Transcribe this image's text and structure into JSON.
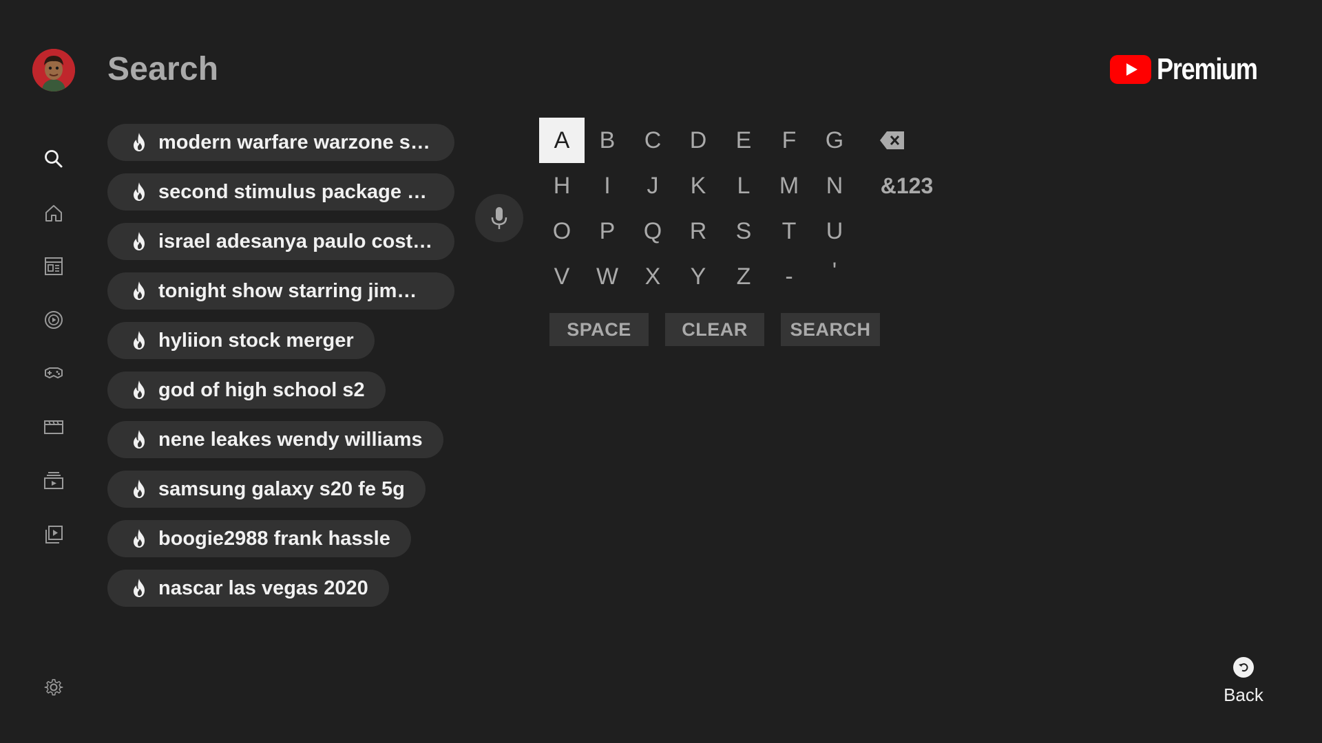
{
  "header": {
    "title": "Search",
    "logo_text": "Premium",
    "logo_icon": "youtube-play-icon",
    "avatar": "user-avatar"
  },
  "nav": {
    "items": [
      {
        "name": "search",
        "icon": "search-icon"
      },
      {
        "name": "home",
        "icon": "home-icon"
      },
      {
        "name": "subscriptions",
        "icon": "subscriptions-icon"
      },
      {
        "name": "music",
        "icon": "music-disc-icon"
      },
      {
        "name": "gaming",
        "icon": "gamepad-icon"
      },
      {
        "name": "movies",
        "icon": "clapperboard-icon"
      },
      {
        "name": "library",
        "icon": "library-icon"
      },
      {
        "name": "your-videos",
        "icon": "playlist-play-icon"
      }
    ],
    "settings_icon": "gear-icon"
  },
  "suggestions": [
    "modern warfare warzone se...",
    "second stimulus package c...",
    "israel adesanya paulo costa...",
    "tonight show starring jimmy...",
    "hyliion stock merger",
    "god of high school s2",
    "nene leakes wendy williams",
    "samsung galaxy s20 fe 5g",
    "boogie2988 frank hassle",
    "nascar las vegas 2020"
  ],
  "keyboard": {
    "rows": [
      [
        "A",
        "B",
        "C",
        "D",
        "E",
        "F",
        "G"
      ],
      [
        "H",
        "I",
        "J",
        "K",
        "L",
        "M",
        "N"
      ],
      [
        "O",
        "P",
        "Q",
        "R",
        "S",
        "T",
        "U"
      ],
      [
        "V",
        "W",
        "X",
        "Y",
        "Z",
        "-",
        "'"
      ]
    ],
    "selected_key": "A",
    "backspace_icon": "backspace-icon",
    "symbols_label": "&123",
    "space_label": "SPACE",
    "clear_label": "CLEAR",
    "search_label": "SEARCH",
    "mic_icon": "microphone-icon"
  },
  "back": {
    "label": "Back",
    "icon": "back-arrow-icon"
  },
  "colors": {
    "background": "#1f1f1f",
    "chip": "#323232",
    "text": "#f1f1f1",
    "muted": "#aaaaaa",
    "brand_red": "#ff0000"
  }
}
